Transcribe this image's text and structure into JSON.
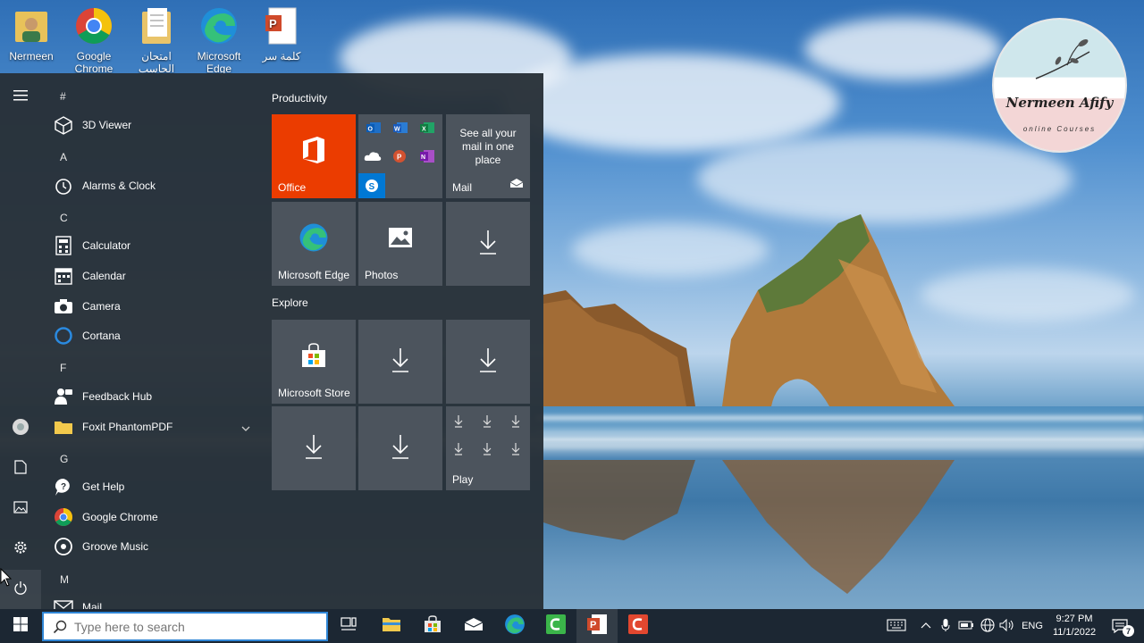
{
  "desktop": {
    "icons": [
      {
        "label": "Nermeen",
        "icon": "user-folder-icon"
      },
      {
        "label": "Google Chrome",
        "icon": "chrome-icon"
      },
      {
        "label": "امتحان الحاسب",
        "icon": "document-folder-icon"
      },
      {
        "label": "Microsoft Edge",
        "icon": "edge-icon"
      },
      {
        "label": "كلمة سر",
        "icon": "powerpoint-file-icon"
      }
    ]
  },
  "logo": {
    "name": "Nermeen Afify",
    "subtitle": "online Courses"
  },
  "start_menu": {
    "rail": [
      "hamburger-icon",
      "user-avatar-icon",
      "documents-icon",
      "pictures-icon",
      "settings-icon",
      "power-icon"
    ],
    "app_list": {
      "groups": [
        {
          "letter": "#",
          "apps": [
            {
              "label": "3D Viewer",
              "icon": "3d-viewer-icon"
            }
          ]
        },
        {
          "letter": "A",
          "apps": [
            {
              "label": "Alarms & Clock",
              "icon": "alarm-clock-icon"
            }
          ]
        },
        {
          "letter": "C",
          "apps": [
            {
              "label": "Calculator",
              "icon": "calculator-icon"
            },
            {
              "label": "Calendar",
              "icon": "calendar-icon"
            },
            {
              "label": "Camera",
              "icon": "camera-icon"
            },
            {
              "label": "Cortana",
              "icon": "cortana-icon"
            }
          ]
        },
        {
          "letter": "F",
          "apps": [
            {
              "label": "Feedback Hub",
              "icon": "feedback-hub-icon"
            },
            {
              "label": "Foxit PhantomPDF",
              "icon": "folder-icon",
              "expandable": true
            }
          ]
        },
        {
          "letter": "G",
          "apps": [
            {
              "label": "Get Help",
              "icon": "get-help-icon"
            },
            {
              "label": "Google Chrome",
              "icon": "chrome-icon"
            },
            {
              "label": "Groove Music",
              "icon": "groove-music-icon"
            }
          ]
        },
        {
          "letter": "M",
          "apps": [
            {
              "label": "Mail",
              "icon": "mail-icon"
            }
          ]
        }
      ]
    },
    "tiles": {
      "productivity_title": "Productivity",
      "explore_title": "Explore",
      "office_label": "Office",
      "mail_label": "Mail",
      "mail_text": "See all your mail in one place",
      "edge_label": "Microsoft Edge",
      "photos_label": "Photos",
      "store_label": "Microsoft Store",
      "play_label": "Play",
      "office_color": "#eb3c00"
    }
  },
  "taskbar": {
    "search_placeholder": "Type here to search",
    "pinned": [
      "task-view-icon",
      "file-explorer-icon",
      "store-icon",
      "mail-icon",
      "edge-icon",
      "camtasia-green-icon",
      "powerpoint-icon",
      "camtasia-red-icon"
    ],
    "tray": {
      "language": "ENG",
      "time": "9:27 PM",
      "date": "11/1/2022",
      "notification_count": "7"
    }
  }
}
